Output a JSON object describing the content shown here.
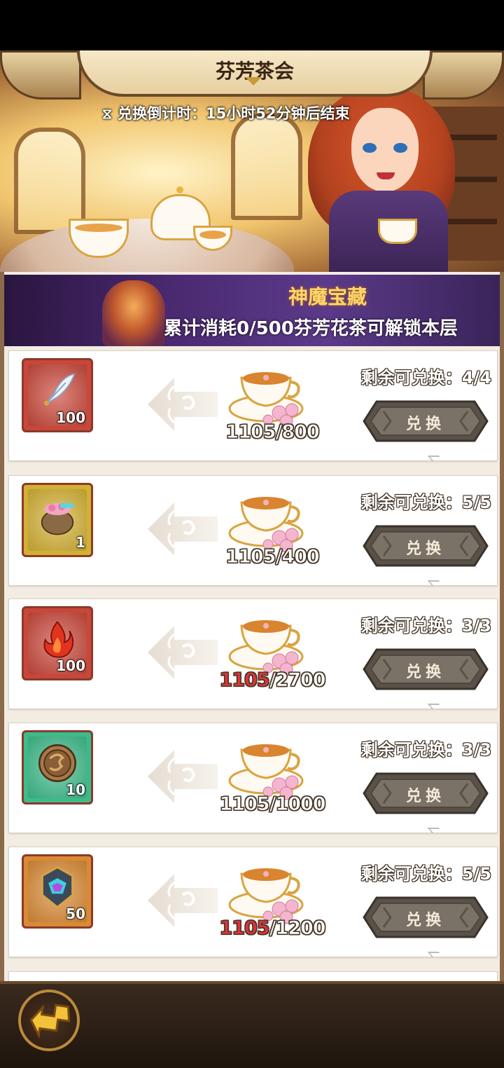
{
  "header": {
    "title": "芬芳茶会",
    "countdown": "兑换倒计时：15小时52分钟后结束"
  },
  "section": {
    "title": "神魔宝藏",
    "unlock_text": "累计消耗0/500芬芳花茶可解锁本层"
  },
  "currency_icon": "rose-tea-cup-icon",
  "items": [
    {
      "icon": "white-feather-icon",
      "frame_color": "#c9473a",
      "qty": "100",
      "have": "1105",
      "need": "800",
      "short": false,
      "remain_label": "剩余可兑换：",
      "remain": "4/4",
      "button": "兑换"
    },
    {
      "icon": "flower-pouch-icon",
      "frame_color": "#d3b034",
      "qty": "1",
      "have": "1105",
      "need": "400",
      "short": false,
      "remain_label": "剩余可兑换：",
      "remain": "5/5",
      "button": "兑换"
    },
    {
      "icon": "red-flame-icon",
      "frame_color": "#c9473a",
      "qty": "100",
      "have": "1105",
      "need": "2700",
      "short": true,
      "remain_label": "剩余可兑换：",
      "remain": "3/3",
      "button": "兑换"
    },
    {
      "icon": "dragon-coin-icon",
      "frame_color": "#3dbb8a",
      "qty": "10",
      "have": "1105",
      "need": "1000",
      "short": false,
      "remain_label": "剩余可兑换：",
      "remain": "3/3",
      "button": "兑换"
    },
    {
      "icon": "crystal-crest-icon",
      "frame_color": "#d98a34",
      "qty": "50",
      "have": "1105",
      "need": "1200",
      "short": true,
      "remain_label": "剩余可兑换：",
      "remain": "5/5",
      "button": "兑换"
    }
  ],
  "footer": {
    "back_icon": "back-arrow-icon"
  }
}
